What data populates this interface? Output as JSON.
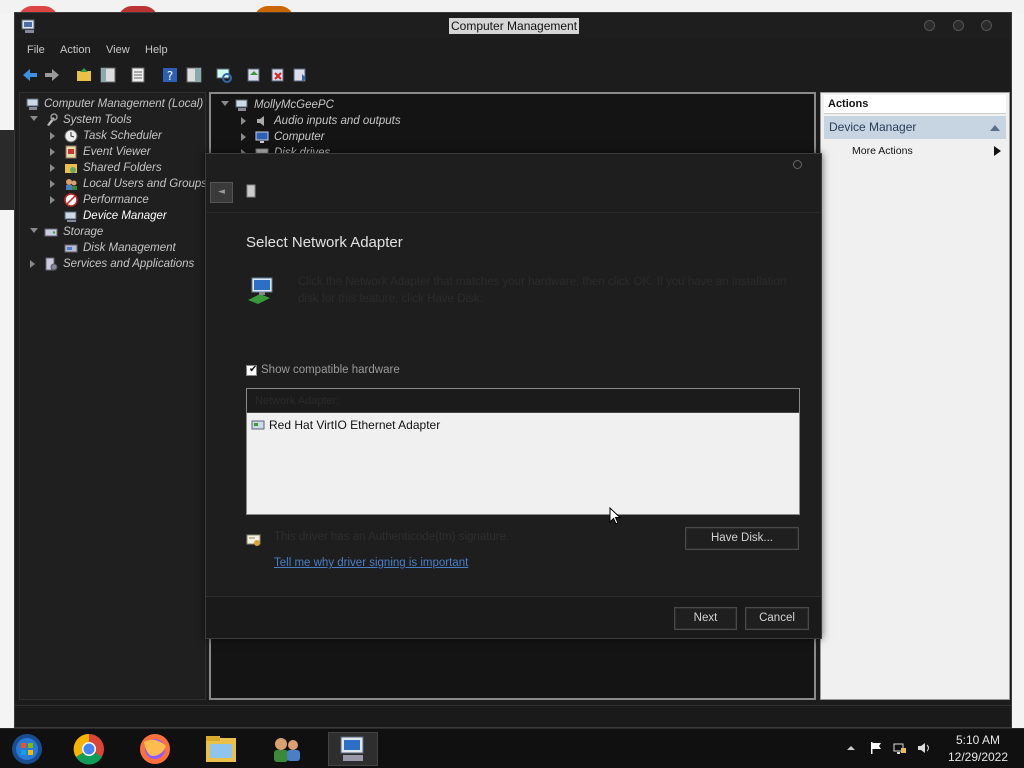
{
  "window": {
    "title": "Computer Management"
  },
  "menu": [
    "File",
    "Action",
    "View",
    "Help"
  ],
  "tree": {
    "root": "Computer Management (Local)",
    "system_tools": "System Tools",
    "task_scheduler": "Task Scheduler",
    "event_viewer": "Event Viewer",
    "shared_folders": "Shared Folders",
    "local_users": "Local Users and Groups",
    "performance": "Performance",
    "device_manager": "Device Manager",
    "storage": "Storage",
    "disk_management": "Disk Management",
    "services": "Services and Applications"
  },
  "devices": {
    "pc": "MollyMcGeePC",
    "audio": "Audio inputs and outputs",
    "computer": "Computer",
    "disk_drives": "Disk drives"
  },
  "actions": {
    "header": "Actions",
    "section": "Device Manager",
    "more": "More Actions"
  },
  "dialog": {
    "title": "Select Network Adapter",
    "instruction": "Click the Network Adapter that matches your hardware, then click OK. If you have an installation disk for this feature, click Have Disk.",
    "show_compatible": "Show compatible hardware",
    "list_header": "Network Adapter:",
    "adapter": "Red Hat VirtIO Ethernet Adapter",
    "signature": "This driver has an Authenticode(tm) signature.",
    "signing_link": "Tell me why driver signing is important",
    "have_disk": "Have Disk...",
    "next": "Next",
    "cancel": "Cancel"
  },
  "clock": {
    "time": "5:10 AM",
    "date": "12/29/2022"
  },
  "colors": {
    "accent_link": "#4a7fc8",
    "actions_section": "#c7d5e3"
  }
}
